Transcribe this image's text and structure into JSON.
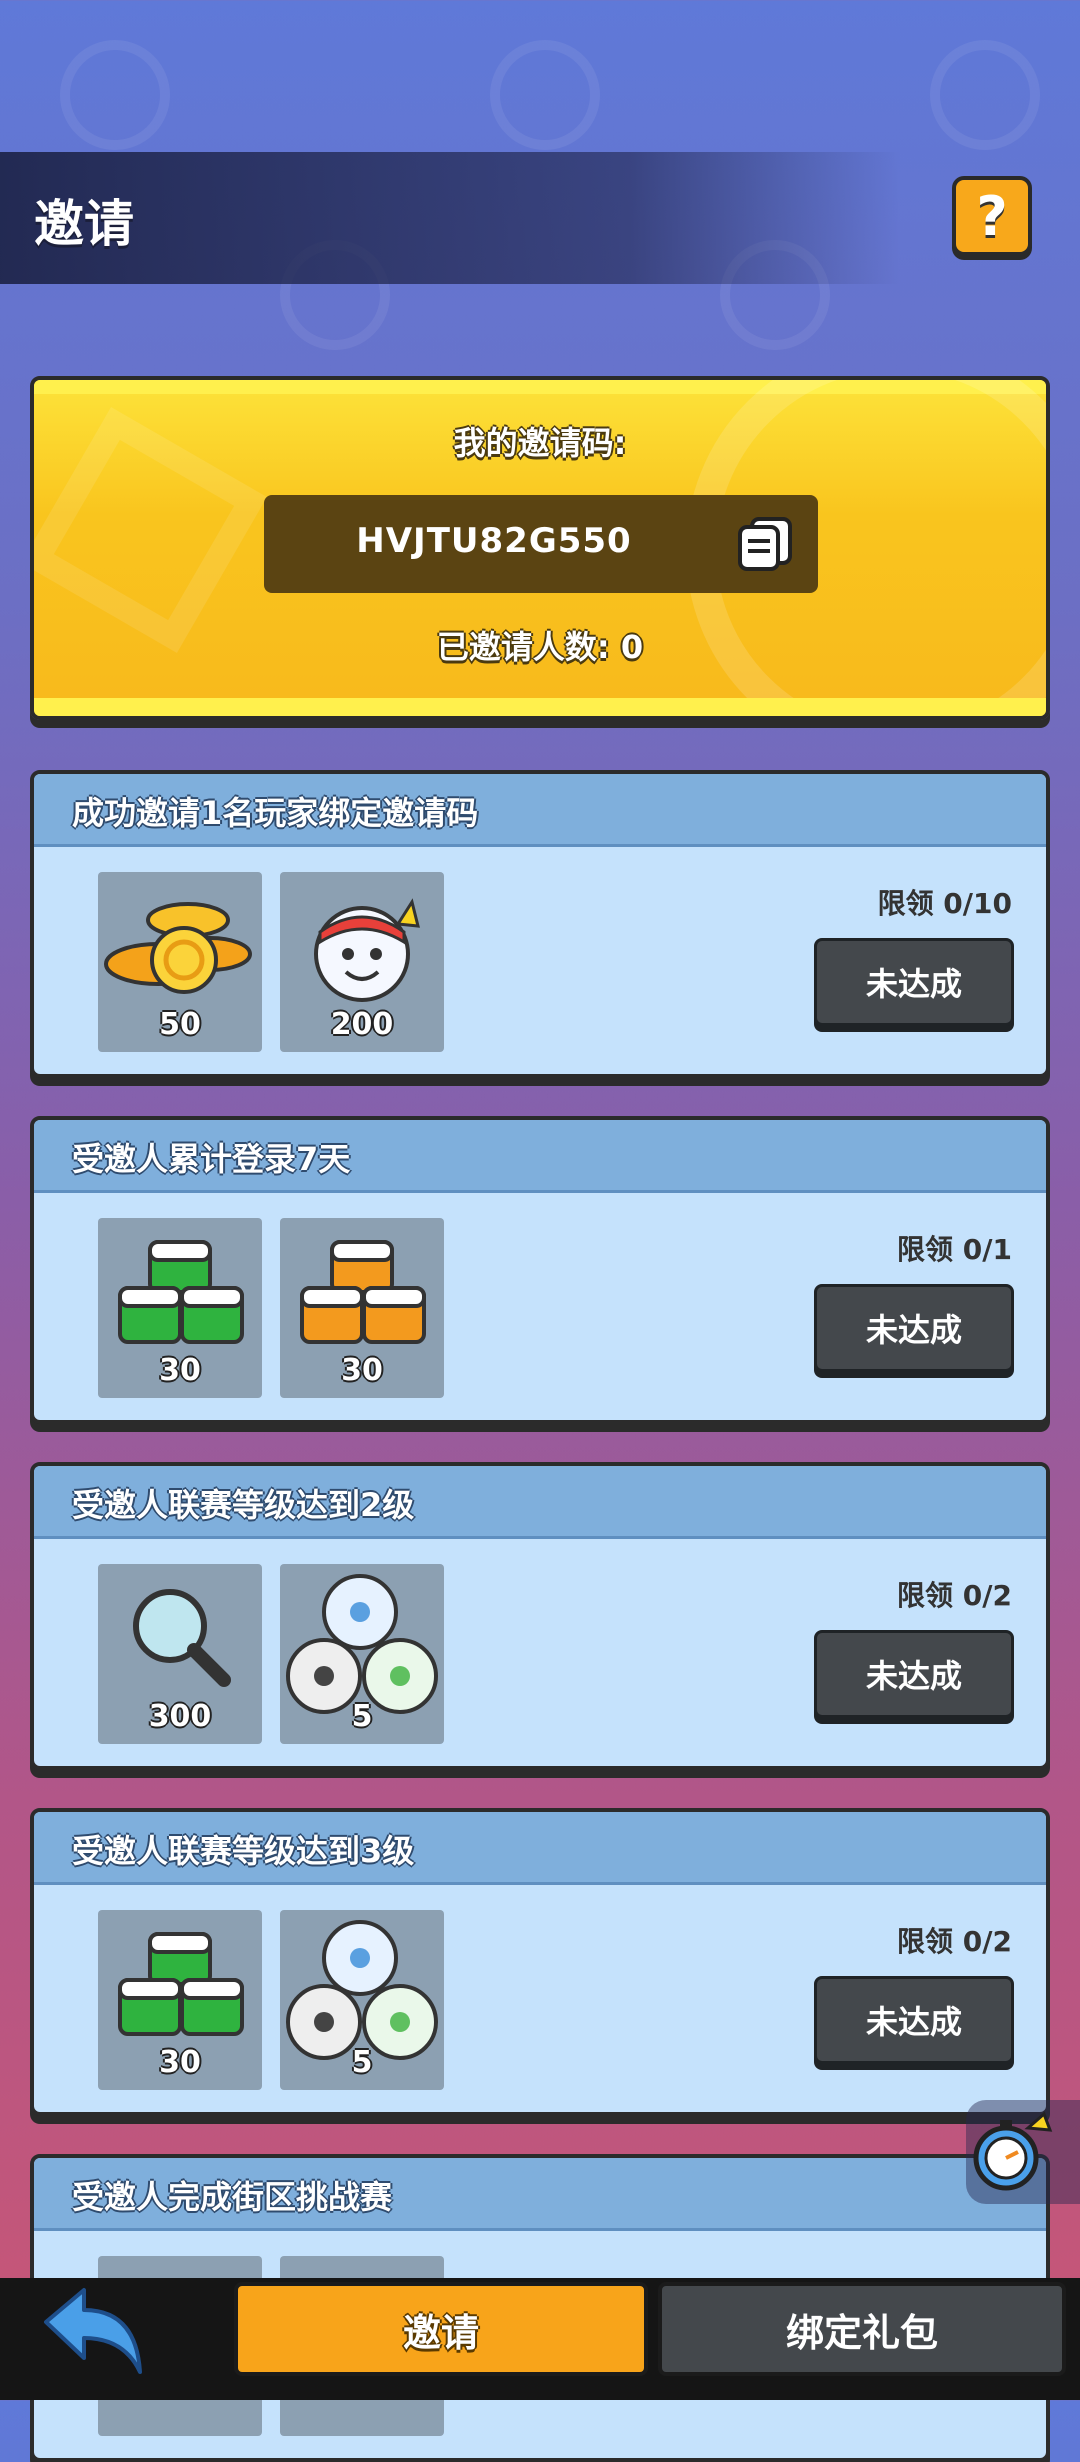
{
  "header": {
    "title": "邀请",
    "help_icon": "question-mark-icon",
    "help_label": "?"
  },
  "invite_code_card": {
    "label": "我的邀请码:",
    "code": "HVJTU82G550",
    "copy_icon": "copy-icon",
    "invited_count_text": "已邀请人数: 0"
  },
  "tasks": [
    {
      "title": "成功邀请1名玩家绑定邀请码",
      "limit": "限领 0/10",
      "status": "未达成",
      "rewards": [
        {
          "icon": "gold-coins-icon",
          "qty": "50"
        },
        {
          "icon": "mascot-head-icon",
          "qty": "200"
        }
      ]
    },
    {
      "title": "受邀人累计登录7天",
      "limit": "限领 0/1",
      "status": "未达成",
      "rewards": [
        {
          "icon": "green-energy-boxes-icon",
          "qty": "30"
        },
        {
          "icon": "orange-energy-boxes-icon",
          "qty": "30"
        }
      ]
    },
    {
      "title": "受邀人联赛等级达到2级",
      "limit": "限领 0/2",
      "status": "未达成",
      "rewards": [
        {
          "icon": "magnifier-icon",
          "qty": "300"
        },
        {
          "icon": "soccer-balls-icon",
          "qty": "5"
        }
      ]
    },
    {
      "title": "受邀人联赛等级达到3级",
      "limit": "限领 0/2",
      "status": "未达成",
      "rewards": [
        {
          "icon": "green-energy-boxes-icon",
          "qty": "30"
        },
        {
          "icon": "soccer-balls-icon",
          "qty": "5"
        }
      ]
    },
    {
      "title": "受邀人完成街区挑战赛"
    }
  ],
  "bottom_nav": {
    "back_icon": "back-arrow-icon",
    "invite_tab": "邀请",
    "bind_tab": "绑定礼包"
  },
  "colors": {
    "accent": "#f8a41a",
    "card_yellow": "#f9c51e",
    "task_bg": "#c5e2fc",
    "task_head": "#7fafdc",
    "button_dark": "#44484c"
  }
}
